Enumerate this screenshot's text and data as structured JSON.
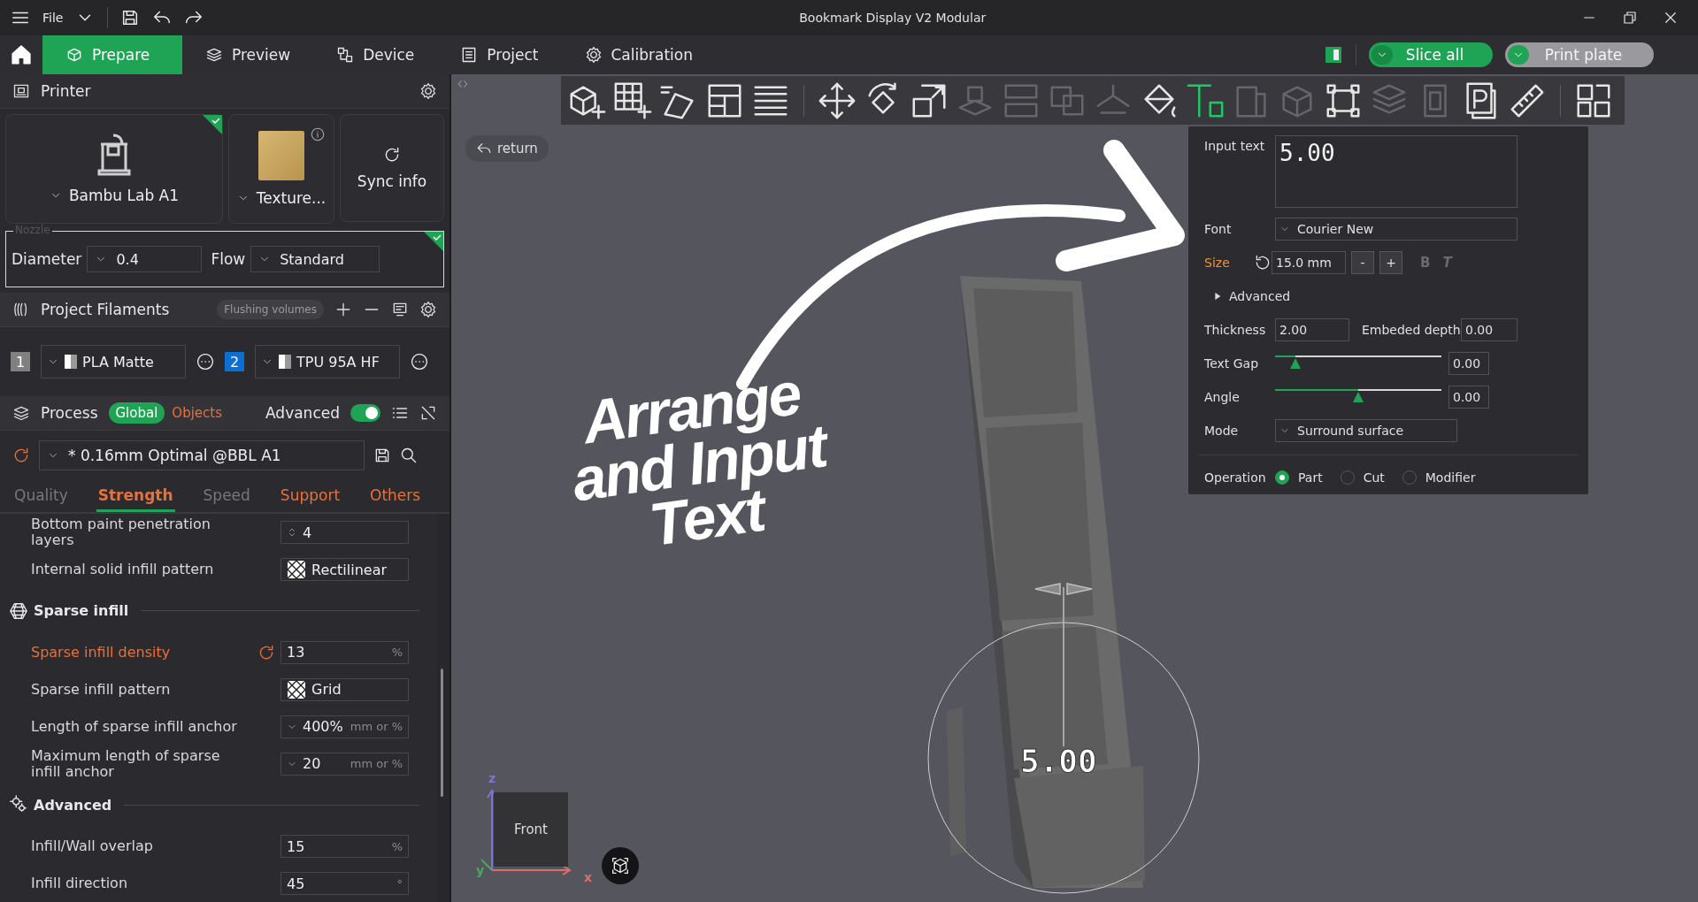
{
  "title_bar": {
    "menu_label": "File",
    "title": "Bookmark Display V2 Modular"
  },
  "tabs": [
    {
      "label": "Prepare",
      "selected": true,
      "kind": "cube"
    },
    {
      "label": "Preview",
      "selected": false,
      "kind": "layers"
    },
    {
      "label": "Device",
      "selected": false,
      "kind": "device"
    },
    {
      "label": "Project",
      "selected": false,
      "kind": "project"
    },
    {
      "label": "Calibration",
      "selected": false,
      "kind": "gear"
    }
  ],
  "actions": [
    {
      "label": "Slice all",
      "kind": "primary"
    },
    {
      "label": "Print plate",
      "kind": "secondary"
    }
  ],
  "printer": {
    "header": "Printer",
    "model": "Bambu Lab A1",
    "model_synced": true,
    "plate": "Texture...",
    "sync_label": "Sync info",
    "nozzle_legend": "Nozzle",
    "nozzle_synced": true,
    "diameter_label": "Diameter",
    "diameter": "0.4",
    "flow_label": "Flow",
    "flow": "Standard"
  },
  "filaments": {
    "header": "Project Filaments",
    "flushing_label": "Flushing volumes",
    "items": [
      {
        "index": "1",
        "color": "#808080",
        "name": "PLA Matte"
      },
      {
        "index": "2",
        "color": "#0b6fd4",
        "name": "TPU 95A HF"
      }
    ]
  },
  "process": {
    "header": "Process",
    "scopes": [
      {
        "label": "Global",
        "selected": true
      },
      {
        "label": "Objects",
        "selected": false
      }
    ],
    "advanced_label": "Advanced",
    "advanced_on": true,
    "preset": "* 0.16mm Optimal @BBL A1",
    "preset_modified": true,
    "tabs": [
      {
        "label": "Quality",
        "selected": false,
        "modified": false
      },
      {
        "label": "Strength",
        "selected": true,
        "modified": true
      },
      {
        "label": "Speed",
        "selected": false,
        "modified": false
      },
      {
        "label": "Support",
        "selected": false,
        "modified": true
      },
      {
        "label": "Others",
        "selected": false,
        "modified": true
      }
    ]
  },
  "settings": [
    {
      "kind": "spin",
      "label": "Bottom paint penetration layers",
      "value": "4",
      "modified": false
    },
    {
      "kind": "pattern",
      "label": "Internal solid infill pattern",
      "value": "Rectilinear",
      "modified": false
    },
    {
      "kind": "infill-section",
      "label": "Sparse infill"
    },
    {
      "kind": "number",
      "label": "Sparse infill density",
      "value": "13",
      "unit": "%",
      "modified": true
    },
    {
      "kind": "pattern",
      "label": "Sparse infill pattern",
      "value": "Grid",
      "modified": false
    },
    {
      "kind": "dropdown",
      "label": "Length of sparse infill anchor",
      "value": "400%",
      "unit": "mm or %",
      "modified": false
    },
    {
      "kind": "dropdown",
      "label": "Maximum length of sparse infill anchor",
      "value": "20",
      "unit": "mm or %",
      "modified": false
    },
    {
      "kind": "advanced-section",
      "label": "Advanced"
    },
    {
      "kind": "number",
      "label": "Infill/Wall overlap",
      "value": "15",
      "unit": "%",
      "modified": false
    },
    {
      "kind": "number",
      "label": "Infill direction",
      "value": "45",
      "unit": "°",
      "modified": false
    }
  ],
  "toolbar": [
    {
      "kind": "cube-plus",
      "disabled": false,
      "selected": false
    },
    {
      "kind": "grid-plus",
      "disabled": false,
      "selected": false
    },
    {
      "kind": "orient",
      "disabled": false,
      "selected": false
    },
    {
      "kind": "arrange",
      "disabled": false,
      "selected": false
    },
    {
      "kind": "list",
      "disabled": false,
      "selected": false
    },
    {
      "kind": "separator"
    },
    {
      "kind": "move",
      "disabled": false,
      "selected": false
    },
    {
      "kind": "rotate",
      "disabled": false,
      "selected": false
    },
    {
      "kind": "scale",
      "disabled": false,
      "selected": false
    },
    {
      "kind": "face",
      "disabled": true,
      "selected": false
    },
    {
      "kind": "split",
      "disabled": true,
      "selected": false
    },
    {
      "kind": "layers",
      "disabled": true,
      "selected": false
    },
    {
      "kind": "lift",
      "disabled": true,
      "selected": false
    },
    {
      "kind": "bucket",
      "disabled": false,
      "selected": false
    },
    {
      "kind": "text",
      "disabled": false,
      "selected": true
    },
    {
      "kind": "box",
      "disabled": true,
      "selected": false
    },
    {
      "kind": "cube",
      "disabled": true,
      "selected": false
    },
    {
      "kind": "frame",
      "disabled": false,
      "selected": false
    },
    {
      "kind": "stack",
      "disabled": true,
      "selected": false
    },
    {
      "kind": "slot",
      "disabled": true,
      "selected": false
    },
    {
      "kind": "plate",
      "disabled": false,
      "selected": false
    },
    {
      "kind": "ruler",
      "disabled": false,
      "selected": false
    },
    {
      "kind": "separator"
    },
    {
      "kind": "assembly",
      "disabled": false,
      "selected": false
    }
  ],
  "viewport": {
    "return_label": "return",
    "overlay_text": "Arrange and Input Text",
    "model_text": "5.00",
    "view_cube_label": "Front",
    "axes": [
      {
        "label": "z",
        "color": "#7d72d8"
      },
      {
        "label": "y",
        "color": "#3fae5a"
      },
      {
        "label": "x",
        "color": "#d9706a"
      }
    ]
  },
  "text_tool": {
    "input_label": "Input text",
    "input_value": "5.00",
    "font_label": "Font",
    "font": "Courier New",
    "size_label": "Size",
    "size_modified": true,
    "size": "15.0 mm",
    "decrease": "-",
    "increase": "+",
    "bold_label": "B",
    "bold": false,
    "italic_label": "T",
    "italic": false,
    "advanced_label": "Advanced",
    "advanced_expanded": false,
    "thickness_label": "Thickness",
    "thickness": "2.00",
    "depth_label": "Embeded depth",
    "depth": "0.00",
    "sliders": [
      {
        "label": "Text Gap",
        "level": 0.12,
        "reading": "0.00"
      },
      {
        "label": "Angle",
        "level": 0.5,
        "reading": "0.00"
      }
    ],
    "mode_label": "Mode",
    "mode": "Surround surface",
    "operation_label": "Operation",
    "operations": [
      {
        "label": "Part",
        "selected": true
      },
      {
        "label": "Cut",
        "selected": false
      },
      {
        "label": "Modifier",
        "selected": false
      }
    ]
  }
}
